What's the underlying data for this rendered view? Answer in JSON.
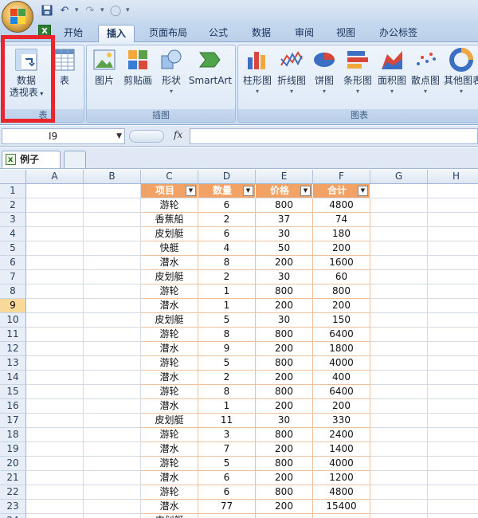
{
  "qat": {
    "undo_icon": "undo-icon",
    "redo_icon": "redo-icon"
  },
  "tabs": [
    "开始",
    "插入",
    "页面布局",
    "公式",
    "数据",
    "审阅",
    "视图",
    "办公标签"
  ],
  "active_tab": "插入",
  "ribbon": {
    "group_table": {
      "label": "表",
      "pivot_line1": "数据",
      "pivot_line2": "透视表",
      "table_label": "表"
    },
    "group_illustrations": {
      "label": "插图",
      "items": [
        "图片",
        "剪贴画",
        "形状",
        "SmartArt"
      ]
    },
    "group_charts": {
      "label": "图表",
      "items": [
        "柱形图",
        "折线图",
        "饼图",
        "条形图",
        "面积图",
        "散点图",
        "其他图表"
      ]
    }
  },
  "formula_bar": {
    "name_box": "I9",
    "fx": "fx",
    "formula": ""
  },
  "workbook": {
    "tab_name": "例子"
  },
  "sheet": {
    "columns": [
      "A",
      "B",
      "C",
      "D",
      "E",
      "F",
      "G",
      "H"
    ],
    "selected_row": 9,
    "headers": [
      "项目",
      "数量",
      "价格",
      "合计"
    ],
    "rows": [
      [
        "游轮",
        "6",
        "800",
        "4800"
      ],
      [
        "香蕉船",
        "2",
        "37",
        "74"
      ],
      [
        "皮划艇",
        "6",
        "30",
        "180"
      ],
      [
        "快艇",
        "4",
        "50",
        "200"
      ],
      [
        "潜水",
        "8",
        "200",
        "1600"
      ],
      [
        "皮划艇",
        "2",
        "30",
        "60"
      ],
      [
        "游轮",
        "1",
        "800",
        "800"
      ],
      [
        "潜水",
        "1",
        "200",
        "200"
      ],
      [
        "皮划艇",
        "5",
        "30",
        "150"
      ],
      [
        "游轮",
        "8",
        "800",
        "6400"
      ],
      [
        "潜水",
        "9",
        "200",
        "1800"
      ],
      [
        "游轮",
        "5",
        "800",
        "4000"
      ],
      [
        "潜水",
        "2",
        "200",
        "400"
      ],
      [
        "游轮",
        "8",
        "800",
        "6400"
      ],
      [
        "潜水",
        "1",
        "200",
        "200"
      ],
      [
        "皮划艇",
        "11",
        "30",
        "330"
      ],
      [
        "游轮",
        "3",
        "800",
        "2400"
      ],
      [
        "潜水",
        "7",
        "200",
        "1400"
      ],
      [
        "游轮",
        "5",
        "800",
        "4000"
      ],
      [
        "潜水",
        "6",
        "200",
        "1200"
      ],
      [
        "游轮",
        "6",
        "800",
        "4800"
      ],
      [
        "潜水",
        "77",
        "200",
        "15400"
      ],
      [
        "皮划艇",
        "",
        "",
        ""
      ]
    ]
  }
}
